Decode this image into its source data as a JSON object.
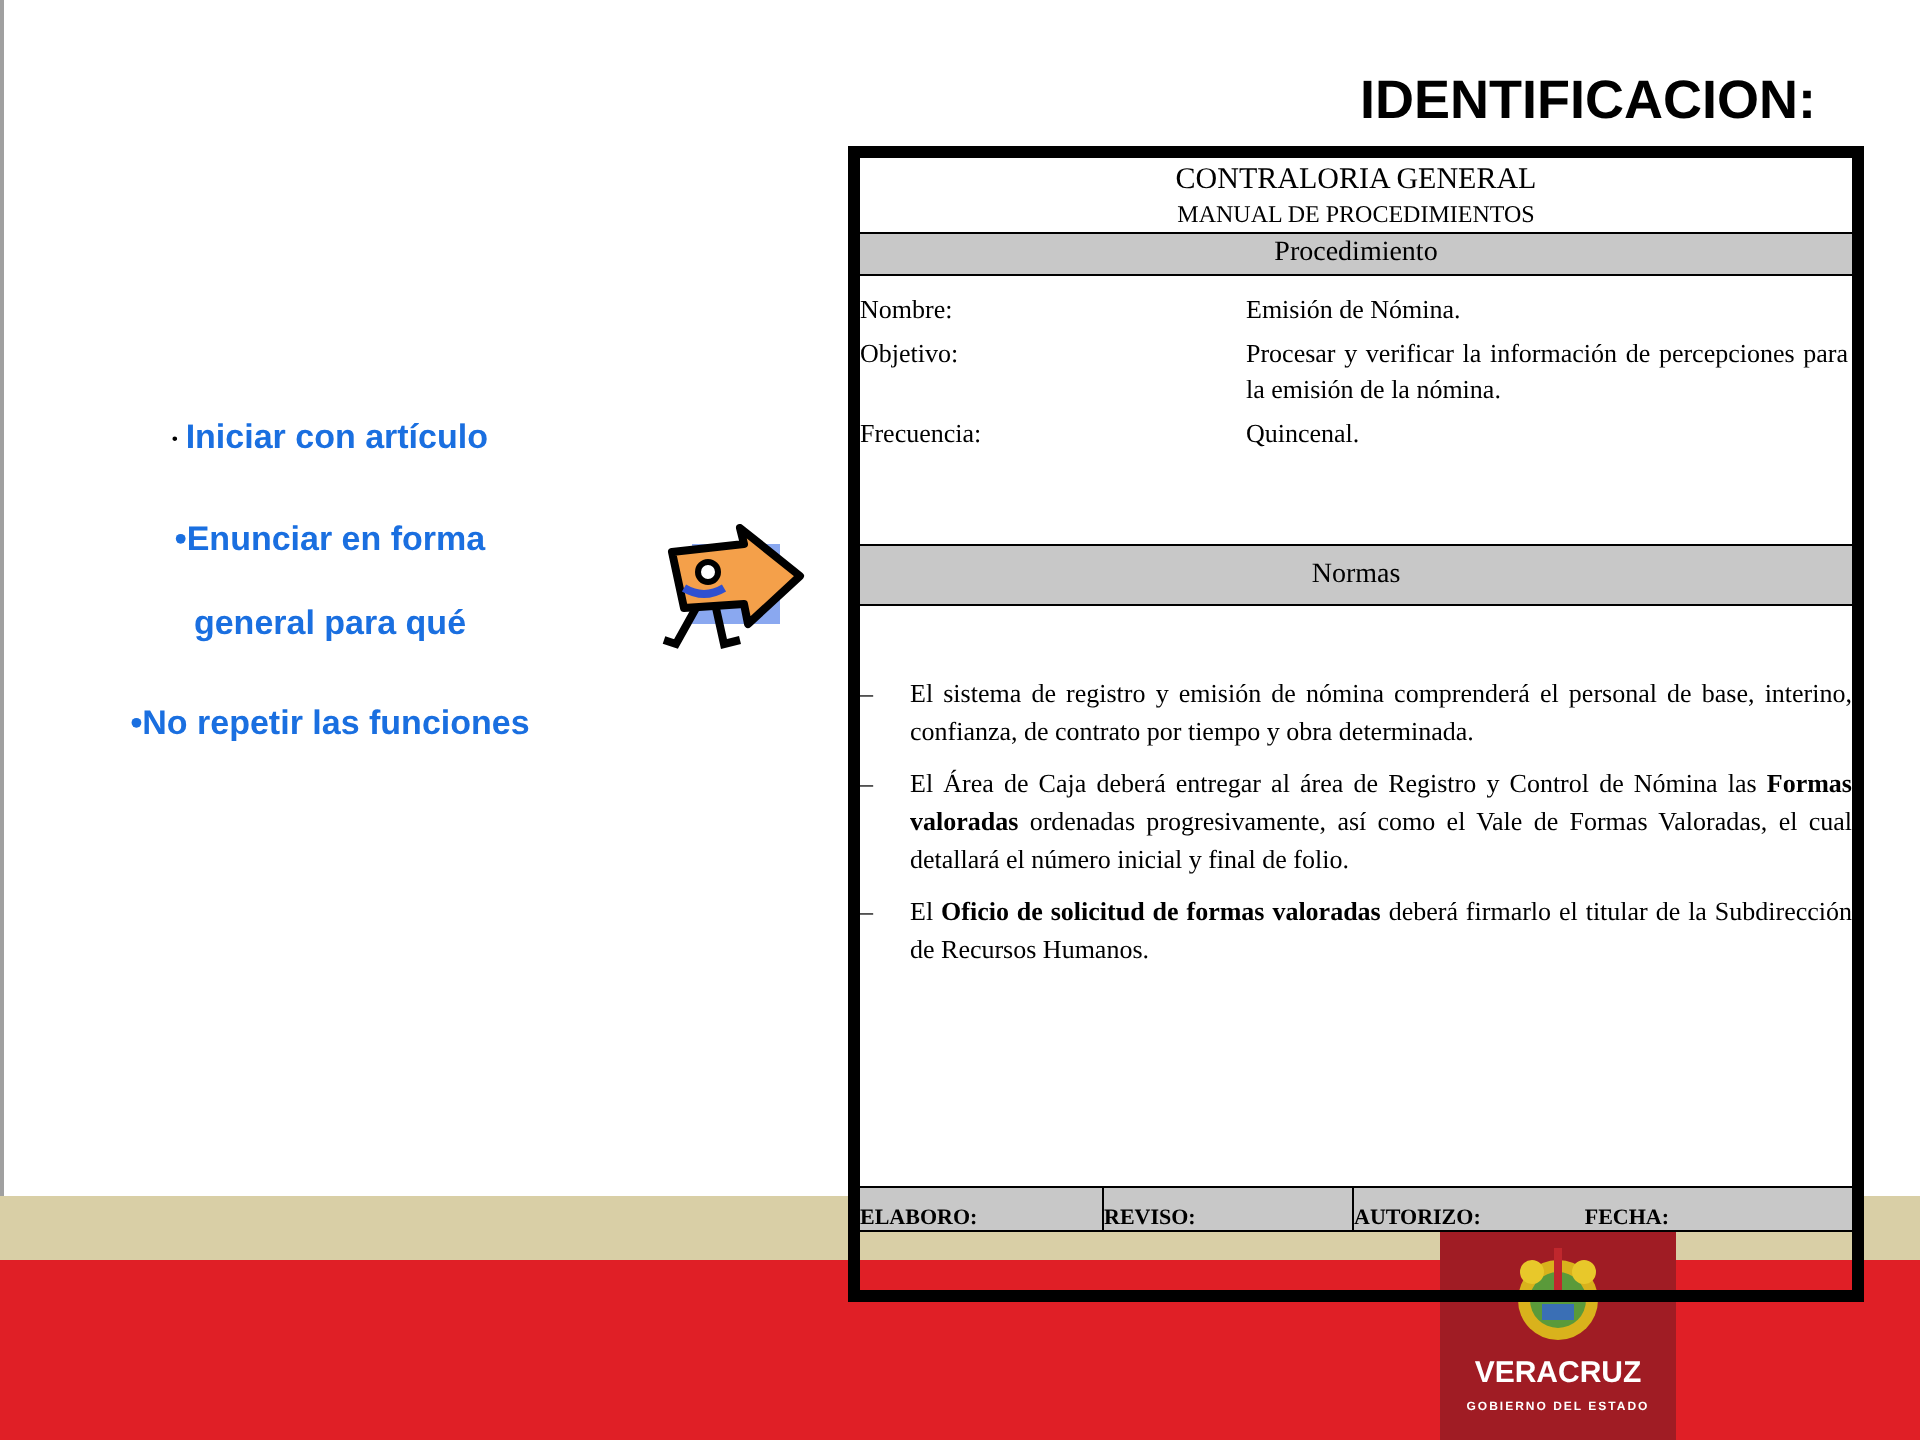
{
  "title": "IDENTIFICACION:",
  "bullets": [
    {
      "bullet": "•",
      "kind": "small",
      "lines": [
        "Iniciar con artículo"
      ]
    },
    {
      "bullet": "•",
      "kind": "inline",
      "lines": [
        "Enunciar en forma",
        "general para qué"
      ]
    },
    {
      "bullet": "•",
      "kind": "inline",
      "lines": [
        "No repetir las funciones"
      ]
    }
  ],
  "document": {
    "header": [
      "CONTRALORIA GENERAL",
      "MANUAL DE PROCEDIMIENTOS"
    ],
    "section_1": "Procedimiento",
    "fields": [
      {
        "label": "Nombre:",
        "value": "Emisión de Nómina."
      },
      {
        "label": "Objetivo:",
        "value": "Procesar y verificar la información de percepciones para la emisión de la nómina."
      },
      {
        "label": "Frecuencia:",
        "value": "Quincenal."
      }
    ],
    "section_2": "Normas",
    "norms": [
      {
        "marker": "–",
        "text": "El sistema de registro y emisión de nómina comprenderá el personal de base, interino, confianza, de contrato por tiempo y obra determinada."
      },
      {
        "marker": "–",
        "text": "El Área de Caja deberá entregar al área de Registro y Control de Nómina las **Formas valoradas** ordenadas progresivamente, así como el Vale de Formas Valoradas, el cual detallará el número inicial y final de folio."
      },
      {
        "marker": "–",
        "text": "El **Oficio de solicitud de formas valoradas** deberá firmarlo el titular de la Subdirección de Recursos Humanos."
      }
    ],
    "signatures": [
      [
        "ELABORO:"
      ],
      [
        "REVISO:"
      ],
      [
        "AUTORIZO:",
        "FECHA:"
      ]
    ]
  },
  "logo": {
    "name": "VERACRUZ",
    "subtitle": "GOBIERNO DEL ESTADO"
  }
}
